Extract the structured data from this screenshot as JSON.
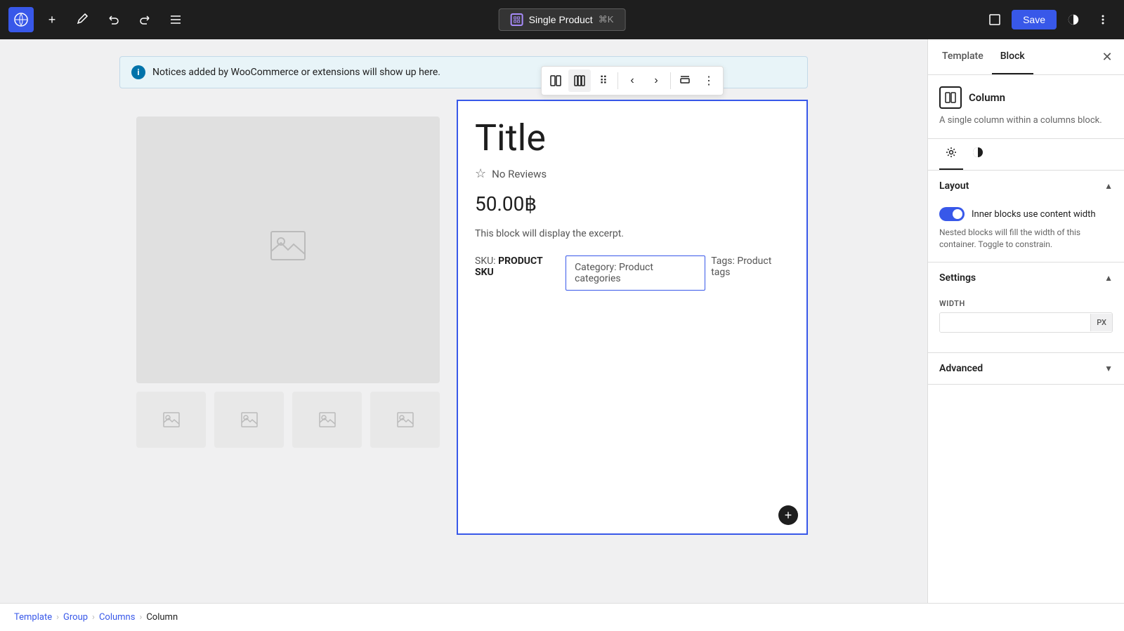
{
  "topbar": {
    "wp_logo": "W",
    "add_btn": "+",
    "edit_btn": "✏",
    "undo_btn": "↩",
    "redo_btn": "↪",
    "list_btn": "≡",
    "center": {
      "product_icon": "⊞",
      "label": "Single Product",
      "shortcut": "⌘K"
    },
    "right": {
      "view_btn": "□",
      "save_label": "Save",
      "styles_btn": "◑",
      "more_btn": "⋮"
    }
  },
  "notice": {
    "icon": "i",
    "text": "Notices added by WooCommerce or extensions will show up here."
  },
  "block_toolbar": {
    "layout_btn": "⊞",
    "columns_btn": "⊡",
    "drag_btn": "⠿",
    "prev_btn": "‹",
    "next_btn": "›",
    "align_btn": "⊤",
    "more_btn": "⋮"
  },
  "product": {
    "title": "Title",
    "rating_star": "☆",
    "rating_text": "No Reviews",
    "price": "50.00฿",
    "excerpt": "This block will display the excerpt.",
    "sku_label": "SKU:",
    "sku_value": "PRODUCT SKU",
    "category_label": "Category:",
    "category_value": "Product categories",
    "tags_label": "Tags:",
    "tags_value": "Product tags"
  },
  "breadcrumb": {
    "items": [
      "Template",
      "Group",
      "Columns",
      "Column"
    ]
  },
  "right_panel": {
    "tabs": [
      "Template",
      "Block"
    ],
    "active_tab": "Block",
    "close_btn": "✕",
    "block": {
      "icon": "▥",
      "name": "Column",
      "description": "A single column within a columns block."
    },
    "settings_tabs": [
      {
        "icon": "⚙",
        "label": "settings"
      },
      {
        "icon": "◑",
        "label": "styles"
      }
    ],
    "layout_section": {
      "title": "Layout",
      "toggle_label": "Inner blocks use content width",
      "toggle_desc": "Nested blocks will fill the width of this container. Toggle to constrain.",
      "toggle_on": true
    },
    "settings_section": {
      "title": "Settings",
      "width_label": "WIDTH",
      "width_value": "",
      "width_unit": "PX"
    },
    "advanced_section": {
      "title": "Advanced"
    }
  },
  "add_block_btn": "+"
}
